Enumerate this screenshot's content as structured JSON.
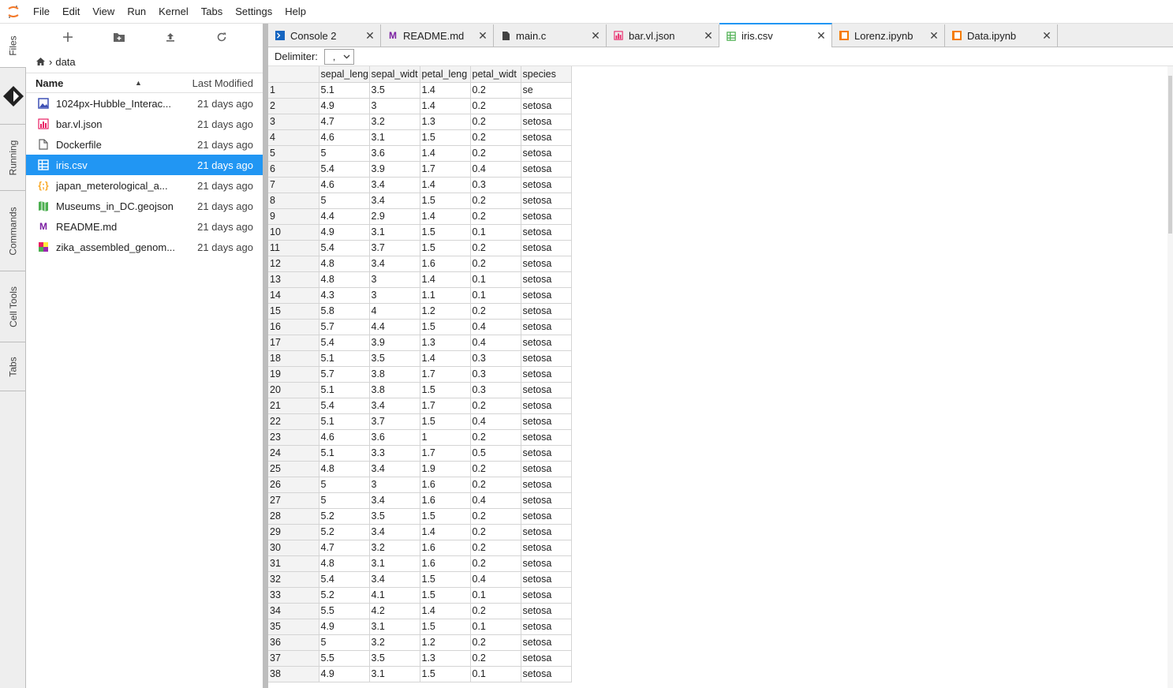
{
  "menubar": {
    "items": [
      "File",
      "Edit",
      "View",
      "Run",
      "Kernel",
      "Tabs",
      "Settings",
      "Help"
    ]
  },
  "sidebar": {
    "tabs": [
      "Files",
      "Running",
      "Commands",
      "Cell Tools",
      "Tabs"
    ]
  },
  "filebrowser": {
    "breadcrumb": "data",
    "header": {
      "name": "Name",
      "modified": "Last Modified"
    },
    "files": [
      {
        "name": "1024px-Hubble_Interac...",
        "modified": "21 days ago",
        "icon": "image-icon"
      },
      {
        "name": "bar.vl.json",
        "modified": "21 days ago",
        "icon": "vega-icon"
      },
      {
        "name": "Dockerfile",
        "modified": "21 days ago",
        "icon": "file-icon"
      },
      {
        "name": "iris.csv",
        "modified": "21 days ago",
        "icon": "spreadsheet-icon"
      },
      {
        "name": "japan_meterological_a...",
        "modified": "21 days ago",
        "icon": "json-icon"
      },
      {
        "name": "Museums_in_DC.geojson",
        "modified": "21 days ago",
        "icon": "map-icon"
      },
      {
        "name": "README.md",
        "modified": "21 days ago",
        "icon": "markdown-icon"
      },
      {
        "name": "zika_assembled_genom...",
        "modified": "21 days ago",
        "icon": "genome-icon"
      }
    ]
  },
  "tabs": [
    {
      "label": "Console 2",
      "icon": "console-icon"
    },
    {
      "label": "README.md",
      "icon": "markdown-icon"
    },
    {
      "label": "main.c",
      "icon": "file-icon"
    },
    {
      "label": "bar.vl.json",
      "icon": "vega-icon"
    },
    {
      "label": "iris.csv",
      "icon": "spreadsheet-icon"
    },
    {
      "label": "Lorenz.ipynb",
      "icon": "notebook-icon"
    },
    {
      "label": "Data.ipynb",
      "icon": "notebook-icon"
    }
  ],
  "csv": {
    "delimiter_label": "Delimiter:",
    "delimiter_value": ",",
    "columns": [
      "sepal_leng",
      "sepal_widt",
      "petal_leng",
      "petal_widt",
      "species"
    ],
    "rows": [
      [
        "1",
        "5.1",
        "3.5",
        "1.4",
        "0.2",
        "se"
      ],
      [
        "2",
        "4.9",
        "3",
        "1.4",
        "0.2",
        "setosa"
      ],
      [
        "3",
        "4.7",
        "3.2",
        "1.3",
        "0.2",
        "setosa"
      ],
      [
        "4",
        "4.6",
        "3.1",
        "1.5",
        "0.2",
        "setosa"
      ],
      [
        "5",
        "5",
        "3.6",
        "1.4",
        "0.2",
        "setosa"
      ],
      [
        "6",
        "5.4",
        "3.9",
        "1.7",
        "0.4",
        "setosa"
      ],
      [
        "7",
        "4.6",
        "3.4",
        "1.4",
        "0.3",
        "setosa"
      ],
      [
        "8",
        "5",
        "3.4",
        "1.5",
        "0.2",
        "setosa"
      ],
      [
        "9",
        "4.4",
        "2.9",
        "1.4",
        "0.2",
        "setosa"
      ],
      [
        "10",
        "4.9",
        "3.1",
        "1.5",
        "0.1",
        "setosa"
      ],
      [
        "11",
        "5.4",
        "3.7",
        "1.5",
        "0.2",
        "setosa"
      ],
      [
        "12",
        "4.8",
        "3.4",
        "1.6",
        "0.2",
        "setosa"
      ],
      [
        "13",
        "4.8",
        "3",
        "1.4",
        "0.1",
        "setosa"
      ],
      [
        "14",
        "4.3",
        "3",
        "1.1",
        "0.1",
        "setosa"
      ],
      [
        "15",
        "5.8",
        "4",
        "1.2",
        "0.2",
        "setosa"
      ],
      [
        "16",
        "5.7",
        "4.4",
        "1.5",
        "0.4",
        "setosa"
      ],
      [
        "17",
        "5.4",
        "3.9",
        "1.3",
        "0.4",
        "setosa"
      ],
      [
        "18",
        "5.1",
        "3.5",
        "1.4",
        "0.3",
        "setosa"
      ],
      [
        "19",
        "5.7",
        "3.8",
        "1.7",
        "0.3",
        "setosa"
      ],
      [
        "20",
        "5.1",
        "3.8",
        "1.5",
        "0.3",
        "setosa"
      ],
      [
        "21",
        "5.4",
        "3.4",
        "1.7",
        "0.2",
        "setosa"
      ],
      [
        "22",
        "5.1",
        "3.7",
        "1.5",
        "0.4",
        "setosa"
      ],
      [
        "23",
        "4.6",
        "3.6",
        "1",
        "0.2",
        "setosa"
      ],
      [
        "24",
        "5.1",
        "3.3",
        "1.7",
        "0.5",
        "setosa"
      ],
      [
        "25",
        "4.8",
        "3.4",
        "1.9",
        "0.2",
        "setosa"
      ],
      [
        "26",
        "5",
        "3",
        "1.6",
        "0.2",
        "setosa"
      ],
      [
        "27",
        "5",
        "3.4",
        "1.6",
        "0.4",
        "setosa"
      ],
      [
        "28",
        "5.2",
        "3.5",
        "1.5",
        "0.2",
        "setosa"
      ],
      [
        "29",
        "5.2",
        "3.4",
        "1.4",
        "0.2",
        "setosa"
      ],
      [
        "30",
        "4.7",
        "3.2",
        "1.6",
        "0.2",
        "setosa"
      ],
      [
        "31",
        "4.8",
        "3.1",
        "1.6",
        "0.2",
        "setosa"
      ],
      [
        "32",
        "5.4",
        "3.4",
        "1.5",
        "0.4",
        "setosa"
      ],
      [
        "33",
        "5.2",
        "4.1",
        "1.5",
        "0.1",
        "setosa"
      ],
      [
        "34",
        "5.5",
        "4.2",
        "1.4",
        "0.2",
        "setosa"
      ],
      [
        "35",
        "4.9",
        "3.1",
        "1.5",
        "0.1",
        "setosa"
      ],
      [
        "36",
        "5",
        "3.2",
        "1.2",
        "0.2",
        "setosa"
      ],
      [
        "37",
        "5.5",
        "3.5",
        "1.3",
        "0.2",
        "setosa"
      ],
      [
        "38",
        "4.9",
        "3.1",
        "1.5",
        "0.1",
        "setosa"
      ]
    ]
  },
  "colors": {
    "accent": "#2196f3",
    "notebook": "#f57c00",
    "markdown": "#7b1fa2",
    "vega": "#e91e63",
    "map": "#4caf50"
  }
}
